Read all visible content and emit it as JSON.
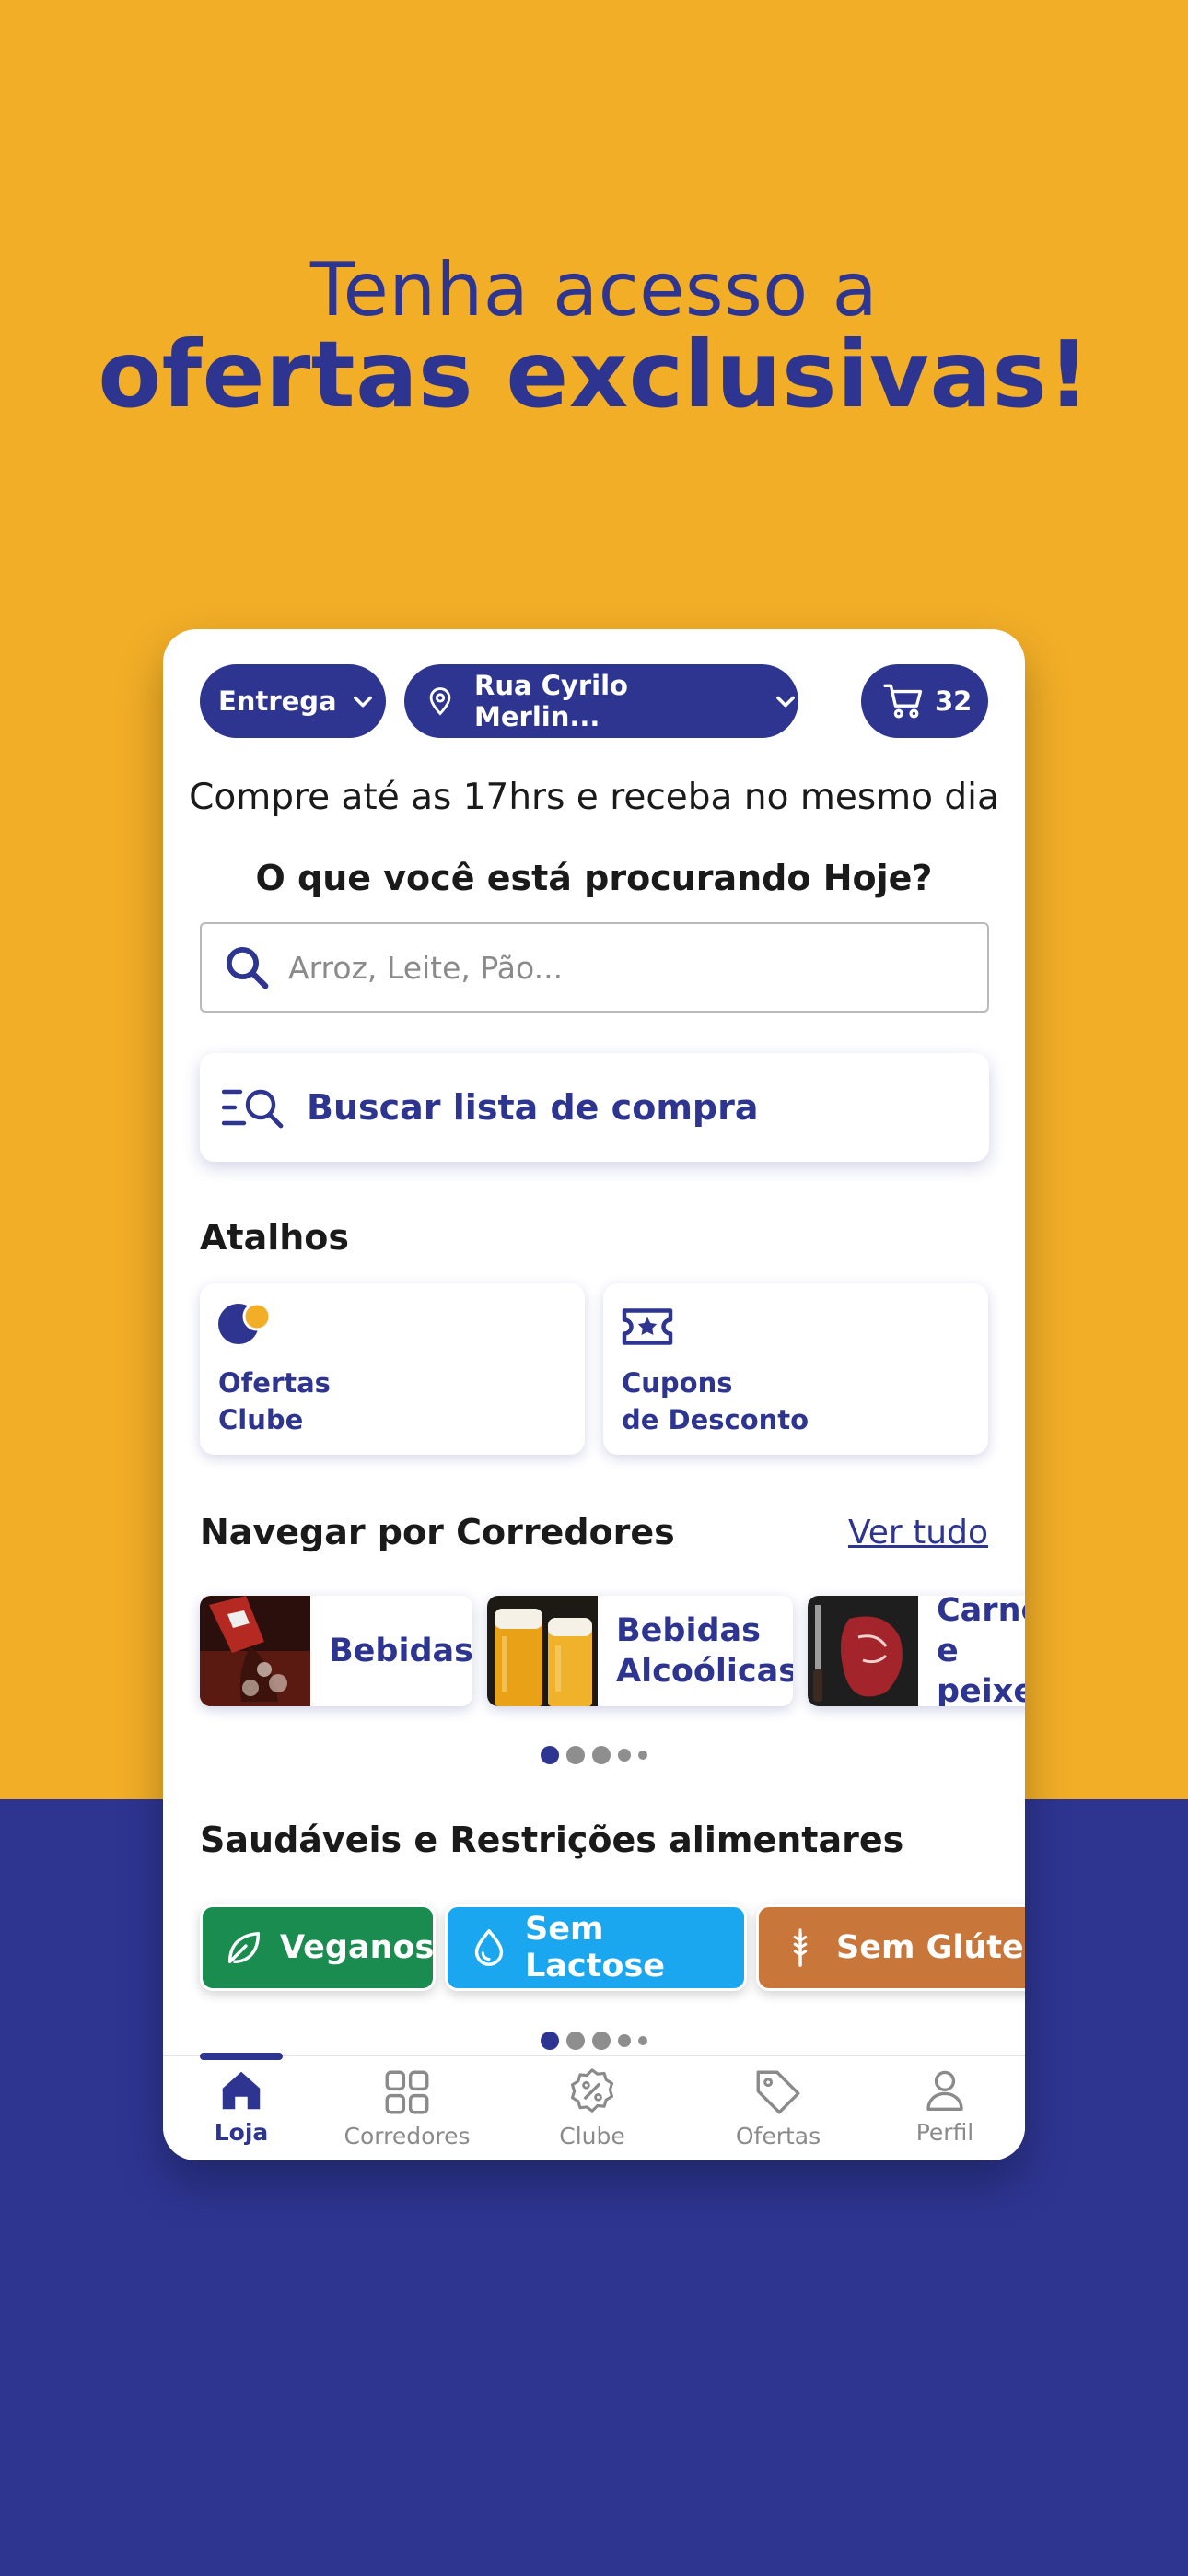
{
  "promo": {
    "line1": "Tenha acesso a",
    "line2": "ofertas exclusivas!"
  },
  "app": {
    "delivery_mode": "Entrega",
    "address": "Rua Cyrilo Merlin...",
    "cart_count": "32",
    "delivery_note": "Compre até as 17hrs e receba no mesmo dia",
    "question": "O que você está procurando Hoje?",
    "search": {
      "placeholder": "Arroz, Leite, Pão..."
    },
    "shopping_list_label": "Buscar lista de compra",
    "shortcuts": {
      "title": "Atalhos",
      "items": [
        {
          "label": "Ofertas\nClube",
          "icon": "club-logo-icon"
        },
        {
          "label": "Cupons\nde Desconto",
          "icon": "ticket-star-icon"
        }
      ]
    },
    "aisles": {
      "title": "Navegar por Corredores",
      "see_all": "Ver tudo",
      "items": [
        {
          "label": "Bebidas",
          "icon": "soda-image"
        },
        {
          "label": "Bebidas\nAlcoólicas",
          "icon": "beer-image"
        },
        {
          "label": "Carnes\ne peixes",
          "icon": "steak-image"
        }
      ]
    },
    "diets": {
      "title": "Saudáveis e Restrições alimentares",
      "items": [
        {
          "label": "Veganos",
          "icon": "leaf-icon",
          "color": "#1A8C50"
        },
        {
          "label": "Sem Lactose",
          "icon": "drop-icon",
          "color": "#1BA7F0"
        },
        {
          "label": "Sem Glúten",
          "icon": "wheat-icon",
          "color": "#C9763A"
        }
      ]
    },
    "tabs": [
      {
        "label": "Loja",
        "icon": "home-icon",
        "active": true
      },
      {
        "label": "Corredores",
        "icon": "grid-icon",
        "active": false
      },
      {
        "label": "Clube",
        "icon": "percent-badge-icon",
        "active": false
      },
      {
        "label": "Ofertas",
        "icon": "tag-icon",
        "active": false
      },
      {
        "label": "Perfil",
        "icon": "user-icon",
        "active": false
      }
    ]
  },
  "colors": {
    "brand_blue": "#2D3591",
    "brand_yellow": "#F2AE27"
  }
}
